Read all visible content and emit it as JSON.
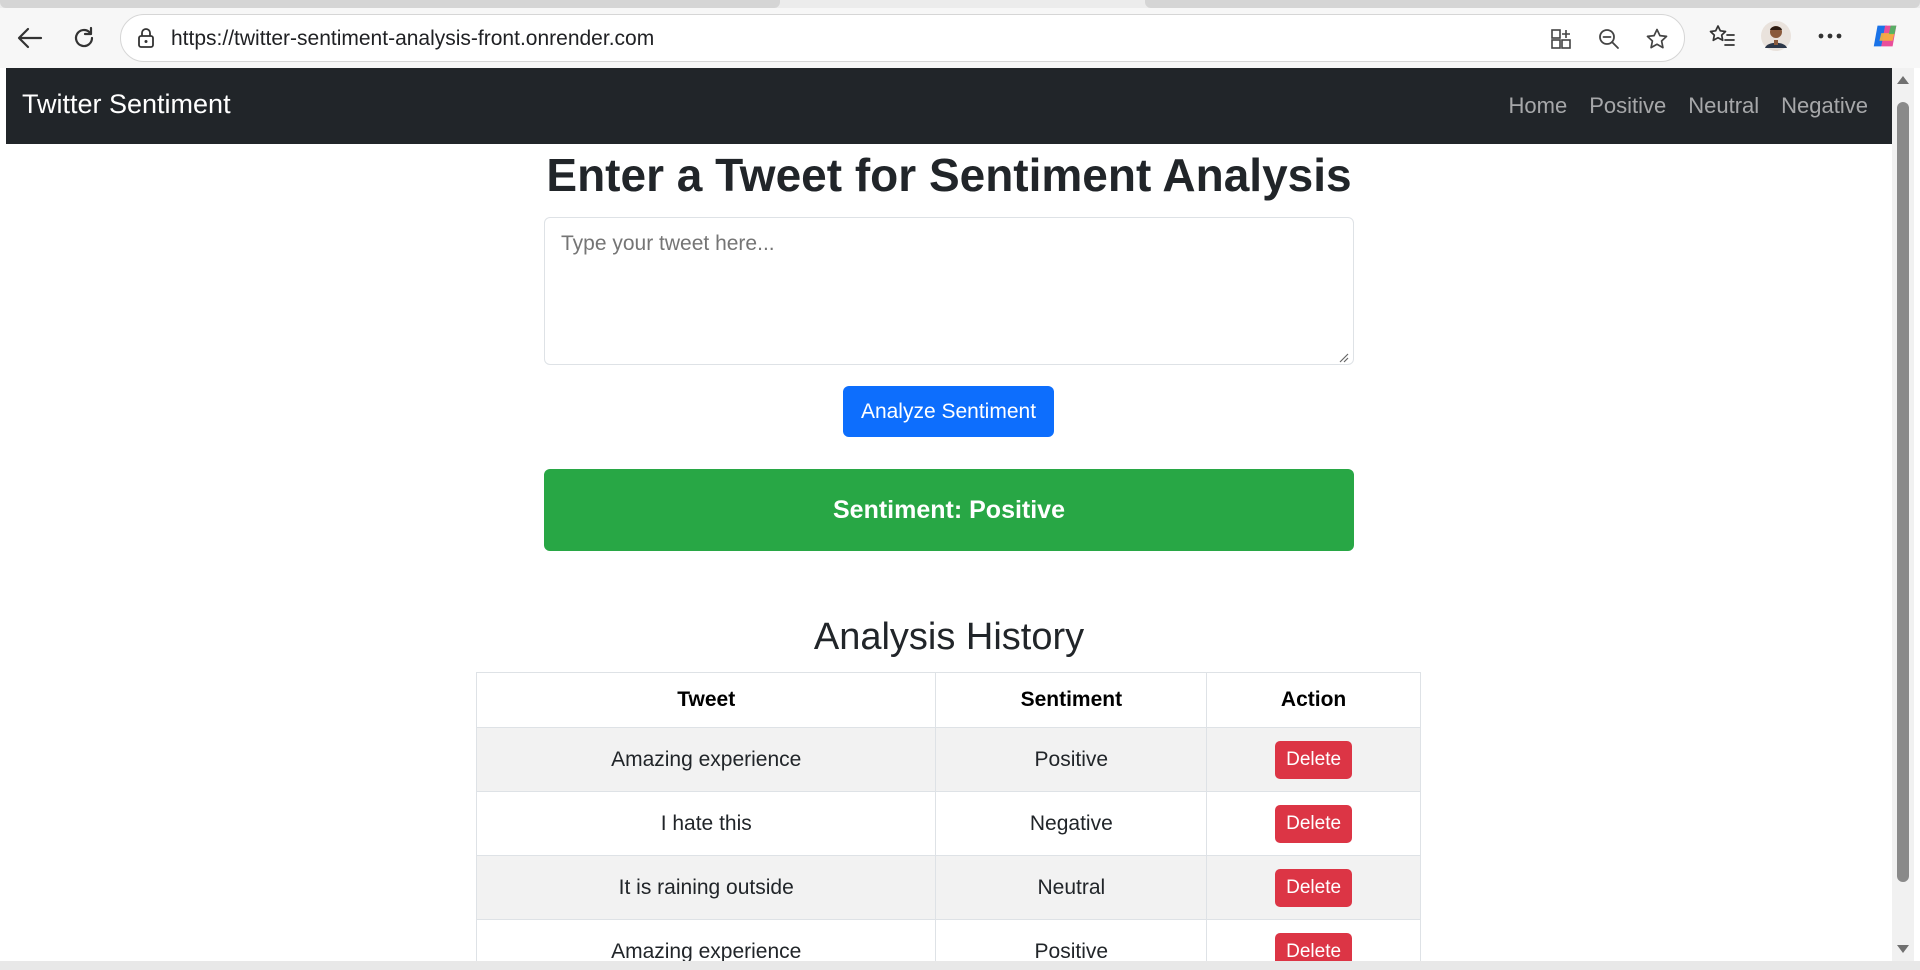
{
  "browser": {
    "url": "https://twitter-sentiment-analysis-front.onrender.com"
  },
  "navbar": {
    "brand": "Twitter Sentiment",
    "links": [
      "Home",
      "Positive",
      "Neutral",
      "Negative"
    ]
  },
  "form": {
    "heading": "Enter a Tweet for Sentiment Analysis",
    "placeholder": "Type your tweet here...",
    "analyze_label": "Analyze Sentiment"
  },
  "result": {
    "text": "Sentiment: Positive",
    "color": "#28a745"
  },
  "history": {
    "heading": "Analysis History",
    "columns": [
      "Tweet",
      "Sentiment",
      "Action"
    ],
    "rows": [
      {
        "tweet": "Amazing experience",
        "sentiment": "Positive",
        "action": "Delete"
      },
      {
        "tweet": "I hate this",
        "sentiment": "Negative",
        "action": "Delete"
      },
      {
        "tweet": "It is raining outside",
        "sentiment": "Neutral",
        "action": "Delete"
      },
      {
        "tweet": "Amazing experience",
        "sentiment": "Positive",
        "action": "Delete"
      }
    ]
  },
  "colors": {
    "navbar": "#212529",
    "primary": "#0d6efd",
    "danger": "#dc3545"
  }
}
